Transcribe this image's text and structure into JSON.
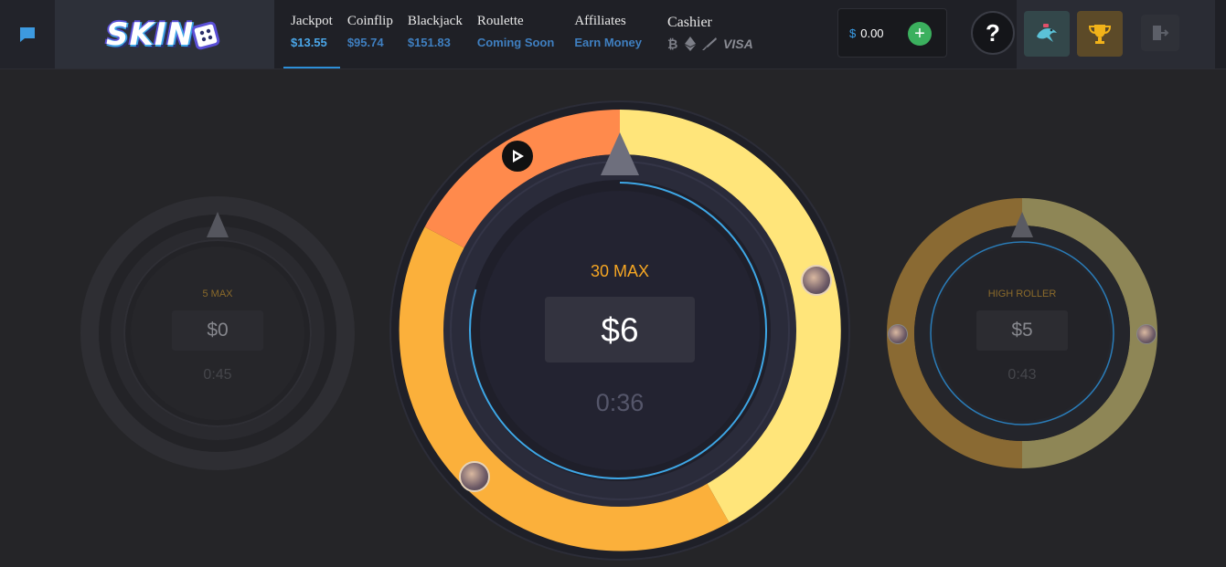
{
  "header": {
    "nav": [
      {
        "title": "Jackpot",
        "sub": "$13.55"
      },
      {
        "title": "Coinflip",
        "sub": "$95.74"
      },
      {
        "title": "Blackjack",
        "sub": "$151.83"
      },
      {
        "title": "Roulette",
        "sub": "Coming Soon"
      },
      {
        "title": "Affiliates",
        "sub": "Earn Money"
      }
    ],
    "logo_text": "SKIN",
    "cashier": {
      "title": "Cashier",
      "methods": [
        "bitcoin-icon",
        "ethereum-icon",
        "knife-icon",
        "VISA"
      ]
    },
    "balance": {
      "currency": "$",
      "amount": "0.00"
    },
    "help_label": "?"
  },
  "jackpots": {
    "left": {
      "label": "5 MAX",
      "amount": "$0",
      "timer": "0:45"
    },
    "center": {
      "label": "30 MAX",
      "amount": "$6",
      "timer": "0:36"
    },
    "right": {
      "label": "HIGH ROLLER",
      "amount": "$5",
      "timer": "0:43"
    }
  },
  "colors": {
    "accent_blue": "#2d8fd8",
    "max_label": "#f5a623",
    "ring_yellow": "#ffe57a",
    "ring_orange": "#ff8a4c",
    "ring_amber": "#fbb03b",
    "add_green": "#3bb05e"
  }
}
